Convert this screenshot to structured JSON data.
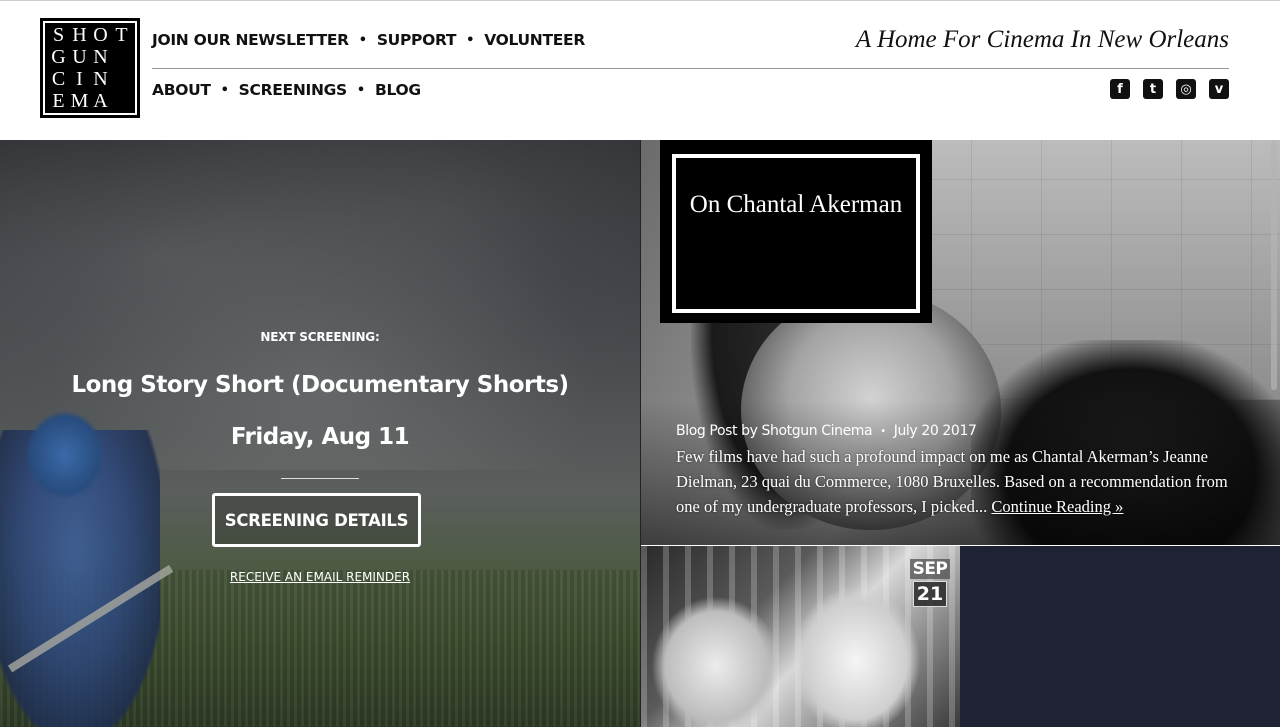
{
  "logo": {
    "letters": [
      "S",
      "H",
      "O",
      "T",
      "G",
      "U",
      "N",
      "",
      "C",
      "I",
      "N",
      "",
      "E",
      "M",
      "A",
      ""
    ],
    "alt": "SHOTGUN CINEMA"
  },
  "nav_top": {
    "items": [
      "JOIN OUR NEWSLETTER",
      "SUPPORT",
      "VOLUNTEER"
    ]
  },
  "nav_bottom": {
    "items": [
      "ABOUT",
      "SCREENINGS",
      "BLOG"
    ]
  },
  "tagline": "A Home For Cinema In New Orleans",
  "social": [
    {
      "name": "facebook-icon",
      "glyph": "f"
    },
    {
      "name": "twitter-icon",
      "glyph": "t"
    },
    {
      "name": "instagram-icon",
      "glyph": "◎"
    },
    {
      "name": "vimeo-icon",
      "glyph": "v"
    }
  ],
  "hero": {
    "label": "NEXT SCREENING:",
    "title": "Long Story Short (Documentary Shorts)",
    "date": "Friday, Aug 11",
    "button": "SCREENING DETAILS",
    "reminder": "RECEIVE AN EMAIL REMINDER"
  },
  "blog": {
    "title": "On Chantal Akerman",
    "byline": "Blog Post by Shotgun Cinema",
    "date": "July 20 2017",
    "excerpt": "Few films have had such a profound impact on me as Chantal Akerman’s Jeanne Dielman, 23 quai du Commerce, 1080 Bruxelles. Based on a recommendation from one of my undergraduate professors, I picked...",
    "more": "Continue Reading »"
  },
  "event": {
    "month": "SEP",
    "day": "21"
  },
  "colors": {
    "navy_tile": "#1e2234",
    "logo_bg": "#000000",
    "text": "#111111"
  }
}
